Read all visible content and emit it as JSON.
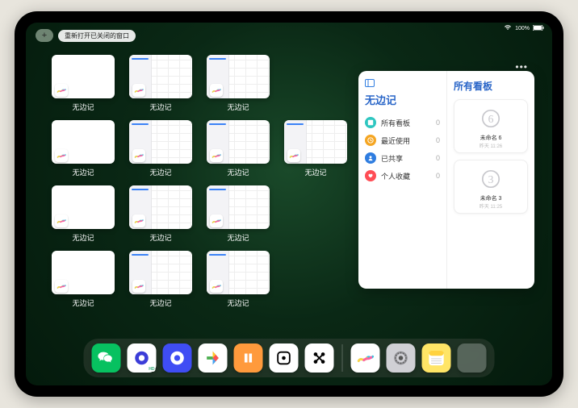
{
  "status_bar": {
    "wifi_icon": "wifi",
    "battery_text": "100%"
  },
  "top_controls": {
    "plus_label": "+",
    "reopen_label": "重新打开已关闭的窗口"
  },
  "app_name": "无边记",
  "thumbnails": [
    {
      "label": "无边记",
      "variant": "blank"
    },
    {
      "label": "无边记",
      "variant": "detail"
    },
    {
      "label": "无边记",
      "variant": "detail"
    },
    {
      "label": "无边记",
      "variant": "blank"
    },
    {
      "label": "无边记",
      "variant": "detail"
    },
    {
      "label": "无边记",
      "variant": "detail"
    },
    {
      "label": "无边记",
      "variant": "detail"
    },
    {
      "label": "无边记",
      "variant": "blank"
    },
    {
      "label": "无边记",
      "variant": "detail"
    },
    {
      "label": "无边记",
      "variant": "detail"
    },
    {
      "label": "无边记",
      "variant": "blank"
    },
    {
      "label": "无边记",
      "variant": "detail"
    },
    {
      "label": "无边记",
      "variant": "detail"
    }
  ],
  "large_panel": {
    "left_title": "无边记",
    "right_title": "所有看板",
    "sidebar_items": [
      {
        "icon_color": "#2ec6c0",
        "label": "所有看板",
        "count": 0
      },
      {
        "icon_color": "#f5a623",
        "label": "最近使用",
        "count": 0
      },
      {
        "icon_color": "#2f7de0",
        "label": "已共享",
        "count": 0
      },
      {
        "icon_color": "#ff4d55",
        "label": "个人收藏",
        "count": 0
      }
    ],
    "boards": [
      {
        "scribble": "6",
        "name": "未命名 6",
        "sub": "昨天 11:26"
      },
      {
        "scribble": "3",
        "name": "未命名 3",
        "sub": "昨天 11:25"
      }
    ]
  },
  "dock": {
    "apps": [
      {
        "name": "wechat",
        "bg": "#07c160"
      },
      {
        "name": "quark-hd",
        "bg": "#ffffff",
        "badge": "HD"
      },
      {
        "name": "quark",
        "bg": "#3f4df4"
      },
      {
        "name": "play-video",
        "bg": "#ffffff"
      },
      {
        "name": "books",
        "bg": "#ff9a3c"
      },
      {
        "name": "dice",
        "bg": "#ffffff"
      },
      {
        "name": "connect-dots",
        "bg": "#ffffff"
      }
    ],
    "recent": [
      {
        "name": "freeform",
        "bg": "#ffffff"
      },
      {
        "name": "settings",
        "bg": "#d0d0d5"
      },
      {
        "name": "notes",
        "bg": "#ffe566"
      },
      {
        "name": "folder",
        "bg": "folder"
      }
    ]
  }
}
